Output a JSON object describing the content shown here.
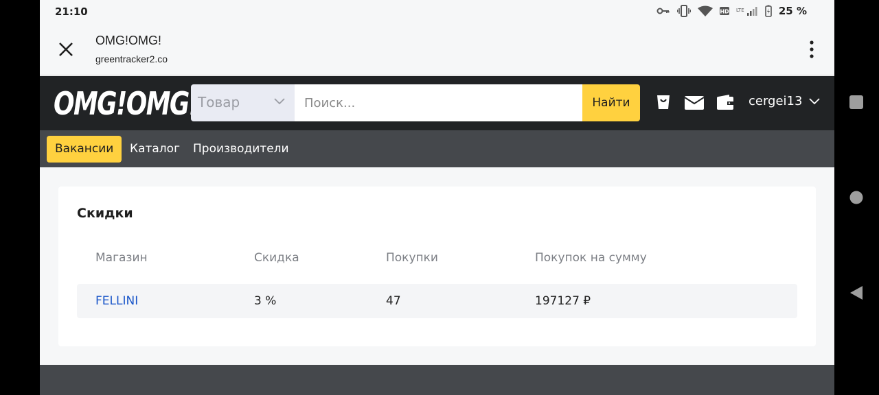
{
  "status_bar": {
    "time": "21:10",
    "battery": "25 %",
    "icons": [
      "key-icon",
      "vibrate-icon",
      "wifi-icon",
      "hd-icon",
      "lte-signal-icon",
      "battery-icon"
    ]
  },
  "tab": {
    "title": "OMG!OMG!",
    "url": "greentracker2.co"
  },
  "header": {
    "logo": "OMG!OMG!",
    "category": "Товар",
    "search_placeholder": "Поиск...",
    "search_button": "Найти",
    "user": "cergei13"
  },
  "nav": {
    "items": [
      {
        "label": "Вакансии",
        "active": true
      },
      {
        "label": "Каталог",
        "active": false
      },
      {
        "label": "Производители",
        "active": false
      }
    ]
  },
  "discounts": {
    "title": "Скидки",
    "columns": [
      "Магазин",
      "Скидка",
      "Покупки",
      "Покупок на сумму"
    ],
    "rows": [
      {
        "shop": "FELLINI",
        "discount": "3 %",
        "purchases": "47",
        "sum": "197127 ₽"
      }
    ]
  },
  "colors": {
    "accent": "#ffd13f",
    "header_bg": "#212325",
    "nav_bg": "#45484c",
    "link": "#1a56c9"
  }
}
